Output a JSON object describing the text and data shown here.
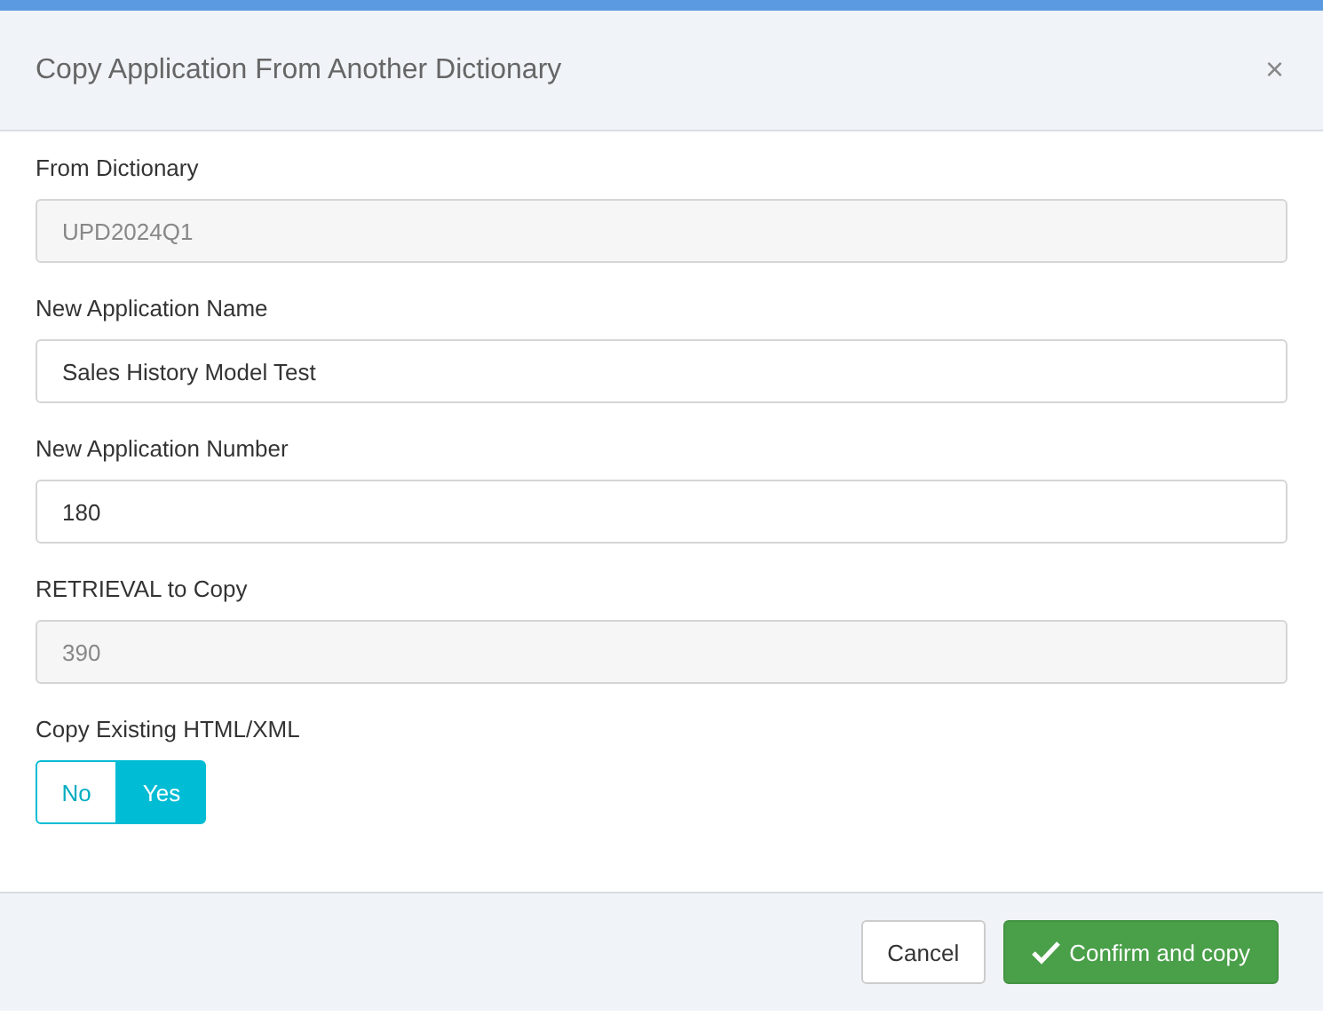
{
  "dialog": {
    "title": "Copy Application From Another Dictionary",
    "close": "×"
  },
  "fields": [
    {
      "label": "From Dictionary",
      "value": "UPD2024Q1",
      "disabled": true
    },
    {
      "label": "New Application Name",
      "value": "Sales History Model Test",
      "disabled": false
    },
    {
      "label": "New Application Number",
      "value": "180",
      "disabled": false
    },
    {
      "label": "RETRIEVAL to Copy",
      "value": "390",
      "disabled": true
    }
  ],
  "toggle": {
    "label": "Copy Existing HTML/XML",
    "options": [
      {
        "label": "No",
        "selected": false
      },
      {
        "label": "Yes",
        "selected": true
      }
    ]
  },
  "buttons": [
    {
      "label": "Cancel",
      "kind": "secondary"
    },
    {
      "label": "Confirm and copy",
      "kind": "primary"
    }
  ]
}
